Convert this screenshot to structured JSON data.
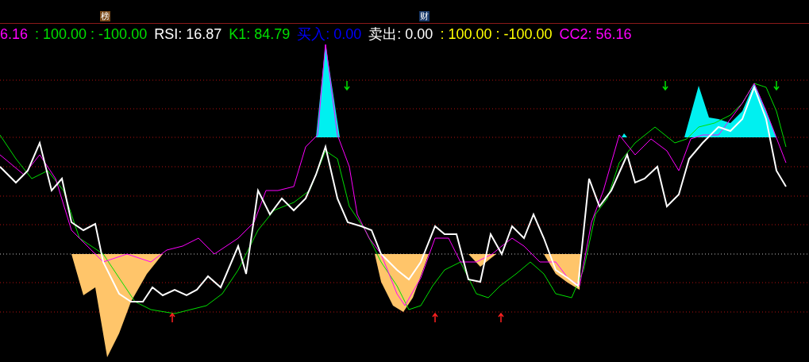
{
  "badges": [
    {
      "text": "榜",
      "color": "#7a4a1a"
    },
    {
      "text": "财",
      "color": "#1a3a6a"
    }
  ],
  "legend": [
    {
      "text": "6.16",
      "color": "#ff00ff"
    },
    {
      "text": ": 100.00 : -100.00",
      "color": "#00e000"
    },
    {
      "text": "RSI: 16.87",
      "color": "#ffffff"
    },
    {
      "text": "K1: 84.79",
      "color": "#00e000"
    },
    {
      "text": "买入: 0.00",
      "color": "#0000ff"
    },
    {
      "text": "卖出: 0.00",
      "color": "#ffffff"
    },
    {
      "text": ": 100.00 : -100.00",
      "color": "#ffff00"
    },
    {
      "text": "CC2: 56.16",
      "color": "#ff00ff"
    }
  ]
}
